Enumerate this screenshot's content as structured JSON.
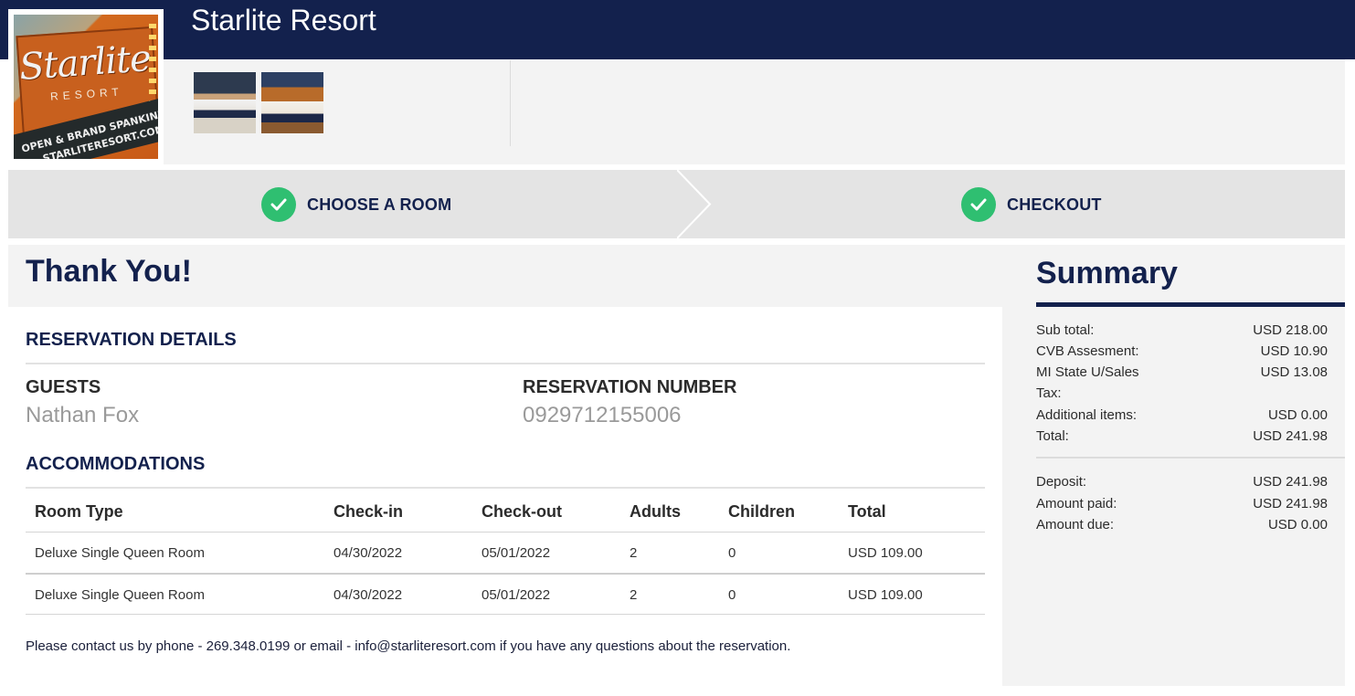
{
  "header": {
    "hotel_name": "Starlite Resort",
    "logo_alt": "Starlite Resort sign: Open & Brand Spankin' New, starliteresort.com",
    "logo_text": {
      "word": "Starlite",
      "sub": "RESORT",
      "line1": "OPEN & BRAND SPANKIN' NEW",
      "line2": "STARLITERESORT.COM"
    }
  },
  "gallery": {
    "thumbnails": [
      "room-photo-1",
      "room-photo-2"
    ]
  },
  "steps": [
    {
      "label": "CHOOSE A ROOM",
      "status": "complete"
    },
    {
      "label": "CHECKOUT",
      "status": "complete"
    }
  ],
  "confirmation": {
    "title": "Thank You!",
    "reservation_details_heading": "RESERVATION DETAILS",
    "guests_label": "GUESTS",
    "guests_value": "Nathan Fox",
    "reservation_number_label": "RESERVATION NUMBER",
    "reservation_number_value": "0929712155006",
    "accommodations_heading": "ACCOMMODATIONS",
    "table": {
      "headers": [
        "Room Type",
        "Check-in",
        "Check-out",
        "Adults",
        "Children",
        "Total"
      ],
      "rows": [
        [
          "Deluxe Single Queen Room",
          "04/30/2022",
          "05/01/2022",
          "2",
          "0",
          "USD 109.00"
        ],
        [
          "Deluxe Single Queen Room",
          "04/30/2022",
          "05/01/2022",
          "2",
          "0",
          "USD 109.00"
        ]
      ]
    },
    "contact": {
      "prefix": "Please contact us by phone - ",
      "phone": "269.348.0199",
      "middle": " or email - ",
      "email": "info@starliteresort.com",
      "suffix": " if you have any questions about the reservation."
    }
  },
  "summary": {
    "title": "Summary",
    "rows": [
      {
        "label": "Sub total:",
        "value": "USD 218.00"
      },
      {
        "label": "CVB Assesment:",
        "value": "USD 10.90"
      },
      {
        "label": "MI State U/Sales Tax:",
        "value": "USD 13.08"
      },
      {
        "label": "Additional items:",
        "value": "USD 0.00"
      },
      {
        "label": "Total:",
        "value": "USD 241.98"
      }
    ],
    "payment_rows": [
      {
        "label": "Deposit:",
        "value": "USD 241.98"
      },
      {
        "label": "Amount paid:",
        "value": "USD 241.98"
      },
      {
        "label": "Amount due:",
        "value": "USD 0.00"
      }
    ]
  },
  "colors": {
    "brand_navy": "#13214d",
    "success_green": "#2fbf71",
    "panel_gray": "#f3f3f3",
    "steps_gray": "#e4e4e4"
  },
  "icons": {
    "step_check": "check-icon"
  }
}
